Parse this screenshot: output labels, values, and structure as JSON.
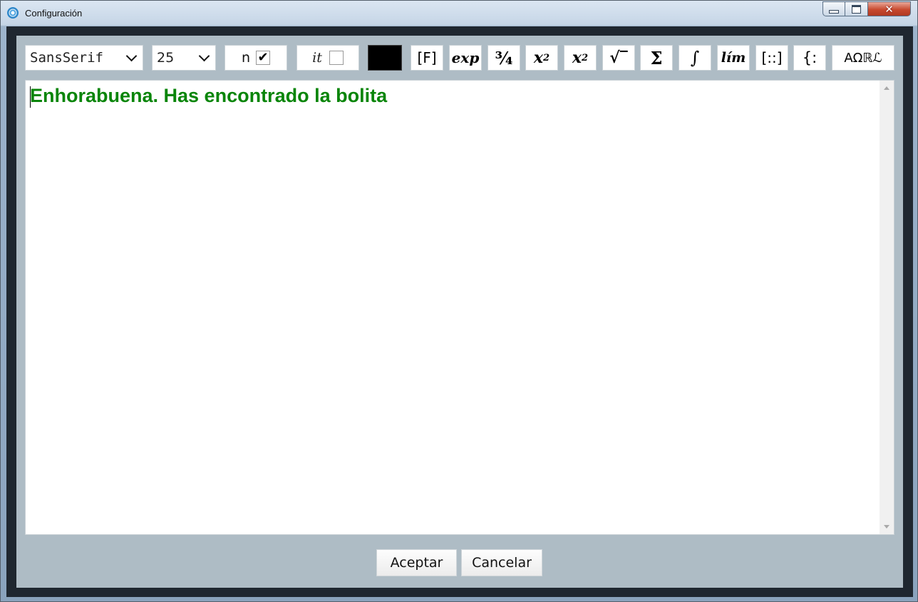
{
  "window": {
    "title": "Configuración",
    "controls": {
      "minimize": "minimize",
      "maximize": "maximize",
      "close": "✕"
    }
  },
  "toolbar": {
    "font_family": "SansSerif",
    "font_size": "25",
    "bold_label": "n",
    "bold_checked": true,
    "italic_label": "it",
    "italic_checked": false,
    "text_color": "#000000",
    "buttons": {
      "fraction_bracket": "[F]",
      "exp": "exp",
      "fraction": "¾",
      "superscript_base": "x",
      "superscript_exp": "2",
      "subscript_base": "x",
      "subscript_idx": "2",
      "sqrt": "√‾",
      "sum": "Σ",
      "integral": "∫",
      "limit": "lím",
      "matrix": "[::]",
      "cases": "{:",
      "symbols": "AΩℝℒ"
    }
  },
  "editor": {
    "text": "Enhorabuena. Has encontrado la bolita",
    "text_color": "#0a850a"
  },
  "footer": {
    "accept_label": "Aceptar",
    "cancel_label": "Cancelar"
  }
}
